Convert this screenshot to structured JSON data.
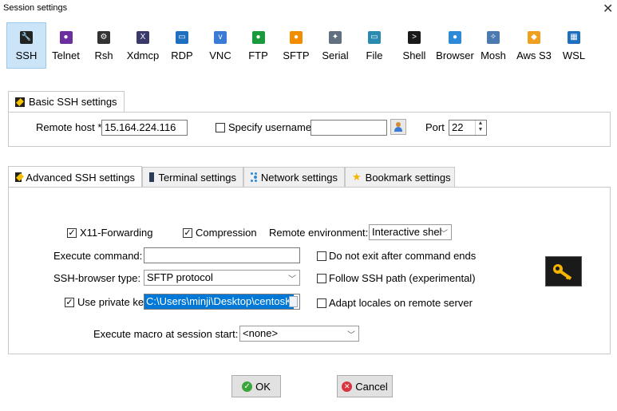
{
  "window": {
    "title": "Session settings",
    "close_glyph": "✕"
  },
  "session_types": [
    {
      "label": "SSH",
      "icon": "ssh-icon",
      "color": "#222222",
      "glyph": "🔧",
      "active": true
    },
    {
      "label": "Telnet",
      "icon": "telnet-icon",
      "color": "#6b2fa0",
      "glyph": "●"
    },
    {
      "label": "Rsh",
      "icon": "rsh-icon",
      "color": "#333333",
      "glyph": "⚙"
    },
    {
      "label": "Xdmcp",
      "icon": "xdmcp-icon",
      "color": "#3a3a6a",
      "glyph": "X"
    },
    {
      "label": "RDP",
      "icon": "rdp-icon",
      "color": "#1e6fc0",
      "glyph": "▭"
    },
    {
      "label": "VNC",
      "icon": "vnc-icon",
      "color": "#3a7bd5",
      "glyph": "v"
    },
    {
      "label": "FTP",
      "icon": "ftp-icon",
      "color": "#1a9a3a",
      "glyph": "●"
    },
    {
      "label": "SFTP",
      "icon": "sftp-icon",
      "color": "#f28c00",
      "glyph": "●"
    },
    {
      "label": "Serial",
      "icon": "serial-icon",
      "color": "#607080",
      "glyph": "✦"
    },
    {
      "label": "File",
      "icon": "file-icon",
      "color": "#2a8ab0",
      "glyph": "▭"
    },
    {
      "label": "Shell",
      "icon": "shell-icon",
      "color": "#1a1a1a",
      "glyph": ">"
    },
    {
      "label": "Browser",
      "icon": "browser-icon",
      "color": "#2c8ad8",
      "glyph": "●"
    },
    {
      "label": "Mosh",
      "icon": "mosh-icon",
      "color": "#4a7ab0",
      "glyph": "✧"
    },
    {
      "label": "Aws S3",
      "icon": "aws-s3-icon",
      "color": "#f0a020",
      "glyph": "◆"
    },
    {
      "label": "WSL",
      "icon": "wsl-icon",
      "color": "#1e6fc0",
      "glyph": "▦"
    }
  ],
  "basic": {
    "tab_label": "Basic SSH settings",
    "remote_host_label": "Remote host *",
    "remote_host_value": "15.164.224.116",
    "specify_username_label": "Specify username",
    "username_value": "",
    "port_label": "Port",
    "port_value": "22"
  },
  "advanced_tabs": [
    {
      "label": "Advanced SSH settings",
      "icon": "wrench-icon",
      "active": true
    },
    {
      "label": "Terminal settings",
      "icon": "terminal-icon"
    },
    {
      "label": "Network settings",
      "icon": "network-icon"
    },
    {
      "label": "Bookmark settings",
      "icon": "star-icon"
    }
  ],
  "advanced": {
    "x11_label": "X11-Forwarding",
    "x11_checked": true,
    "compression_label": "Compression",
    "compression_checked": true,
    "remote_env_label": "Remote environment:",
    "remote_env_value": "Interactive shel",
    "execute_command_label": "Execute command:",
    "execute_command_value": "",
    "do_not_exit_label": "Do not exit after command ends",
    "do_not_exit_checked": false,
    "ssh_browser_label": "SSH-browser type:",
    "ssh_browser_value": "SFTP protocol",
    "follow_path_label": "Follow SSH path (experimental)",
    "follow_path_checked": false,
    "private_key_label": "Use private key",
    "private_key_checked": true,
    "private_key_value": "C:\\Users\\minji\\Desktop\\centosK",
    "adapt_locales_label": "Adapt locales on remote server",
    "adapt_locales_checked": false,
    "macro_label": "Execute macro at session start:",
    "macro_value": "<none>"
  },
  "buttons": {
    "ok_label": "OK",
    "cancel_label": "Cancel"
  },
  "colors": {
    "active_type_bg": "#cce4f7",
    "selection": "#0078d7",
    "ok_green": "#3aa53a",
    "cancel_red": "#d9333f",
    "key_gold": "#f5b400"
  }
}
